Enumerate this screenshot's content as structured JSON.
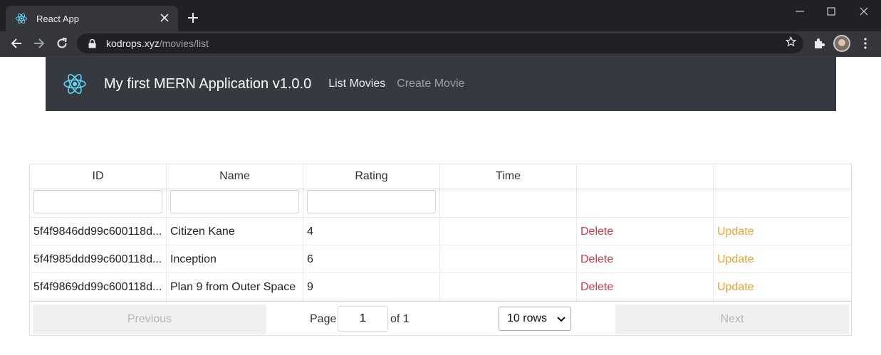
{
  "browser": {
    "tab_title": "React App",
    "url_host": "kodrops.xyz",
    "url_path": "/movies/list",
    "icons": [
      "react-favicon",
      "close-icon",
      "plus-icon",
      "minimize-icon",
      "maximize-icon",
      "window-close-icon",
      "back-arrow-icon",
      "forward-arrow-icon",
      "reload-icon",
      "lock-icon",
      "star-icon",
      "extensions-icon",
      "profile-avatar",
      "kebab-menu-icon"
    ]
  },
  "navbar": {
    "brand_title": "My first MERN Application v1.0.0",
    "links": [
      {
        "label": "List Movies",
        "active": true
      },
      {
        "label": "Create Movie",
        "active": false
      }
    ],
    "background": "#343a40",
    "logo_color": "#61dafb"
  },
  "table": {
    "headers": [
      "ID",
      "Name",
      "Rating",
      "Time",
      "",
      ""
    ],
    "rows": [
      {
        "id": "5f4f9846dd99c600118d...",
        "name": "Citizen Kane",
        "rating": "4",
        "time": "",
        "delete": "Delete",
        "update": "Update"
      },
      {
        "id": "5f4f985ddd99c600118d...",
        "name": "Inception",
        "rating": "6",
        "time": "",
        "delete": "Delete",
        "update": "Update"
      },
      {
        "id": "5f4f9869dd99c600118d...",
        "name": "Plan 9 from Outer Space",
        "rating": "9",
        "time": "",
        "delete": "Delete",
        "update": "Update"
      }
    ],
    "delete_color": "#dc3545",
    "update_color": "#f0a030"
  },
  "pagination": {
    "previous_label": "Previous",
    "page_label": "Page",
    "current_page": "1",
    "of_label": "of 1",
    "rows_option": "10 rows",
    "next_label": "Next"
  }
}
